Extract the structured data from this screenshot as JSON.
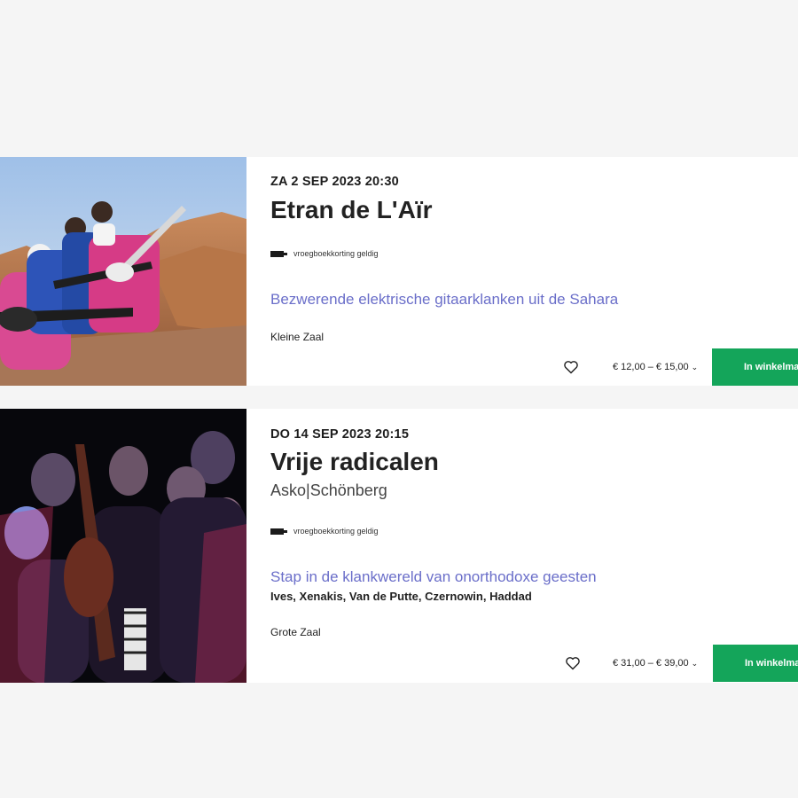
{
  "events": [
    {
      "date": "ZA 2 SEP 2023 20:30",
      "title": "Etran de L'Aïr",
      "promo": "vroegboekkorting geldig",
      "tagline": "Bezwerende elektrische gitaarklanken uit de Sahara",
      "venue": "Kleine Zaal",
      "price": "€ 12,00 – € 15,00",
      "price_icon": "chevron-down-icon",
      "favorite_icon": "heart-icon",
      "cart_label": "In winkelmand"
    },
    {
      "date": "DO 14 SEP 2023 20:15",
      "title": "Vrije radicalen",
      "subtitle": "Asko|Schönberg",
      "promo": "vroegboekkorting geldig",
      "tagline": "Stap in de klankwereld van onorthodoxe geesten",
      "composers": "Ives, Xenakis, Van de Putte, Czernowin, Haddad",
      "venue": "Grote Zaal",
      "price": "€ 31,00 – € 39,00",
      "price_icon": "chevron-down-icon",
      "favorite_icon": "heart-icon",
      "cart_label": "In winkelmand"
    }
  ],
  "colors": {
    "background": "#f5f5f5",
    "card": "#ffffff",
    "tagline": "#6a6ec9",
    "cart_button": "#14a55a"
  }
}
